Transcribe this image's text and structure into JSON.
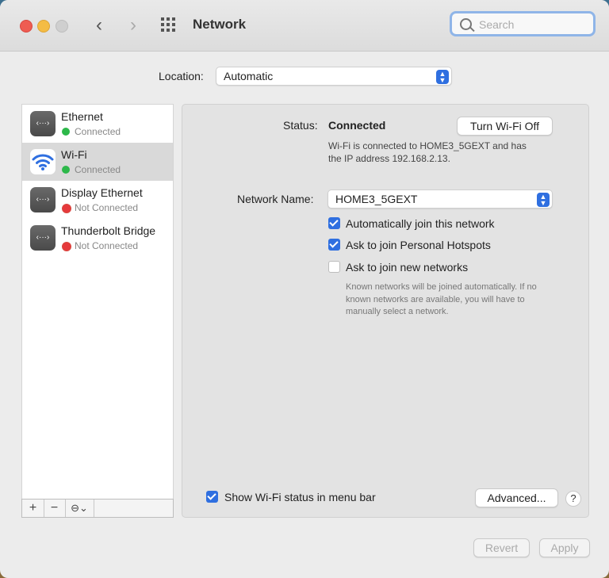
{
  "window": {
    "title": "Network"
  },
  "search": {
    "placeholder": "Search"
  },
  "location": {
    "label": "Location:",
    "value": "Automatic"
  },
  "sidebar": {
    "items": [
      {
        "name": "Ethernet",
        "status": "Connected",
        "status_color": "#2db84a"
      },
      {
        "name": "Wi-Fi",
        "status": "Connected",
        "status_color": "#2db84a"
      },
      {
        "name": "Display Ethernet",
        "status": "Not Connected",
        "status_color": "#e6393c"
      },
      {
        "name": "Thunderbolt Bridge",
        "status": "Not Connected",
        "status_color": "#e6393c"
      }
    ],
    "toolbar": {
      "add": "+",
      "remove": "−",
      "action": "⊖⌄"
    }
  },
  "detail": {
    "status_label": "Status:",
    "status_value": "Connected",
    "turn_off_button": "Turn Wi-Fi Off",
    "status_desc_line1": "Wi-Fi is connected to HOME3_5GEXT and has",
    "status_desc_line2": "the IP address 192.168.2.13.",
    "network_name_label": "Network Name:",
    "network_name_value": "HOME3_5GEXT",
    "options": [
      {
        "label": "Automatically join this network",
        "checked": true
      },
      {
        "label": "Ask to join Personal Hotspots",
        "checked": true
      },
      {
        "label": "Ask to join new networks",
        "checked": false
      }
    ],
    "note_line1": "Known networks will be joined automatically. If no",
    "note_line2": "known networks are available, you will have to",
    "note_line3": "manually select a network.",
    "show_status_label": "Show Wi-Fi status in menu bar",
    "show_status_checked": true,
    "advanced_button": "Advanced...",
    "help_button": "?"
  },
  "footer": {
    "revert_button": "Revert",
    "apply_button": "Apply"
  },
  "colors": {
    "accent": "#2f6fe0",
    "connected": "#2db84a",
    "not_connected": "#e6393c"
  }
}
